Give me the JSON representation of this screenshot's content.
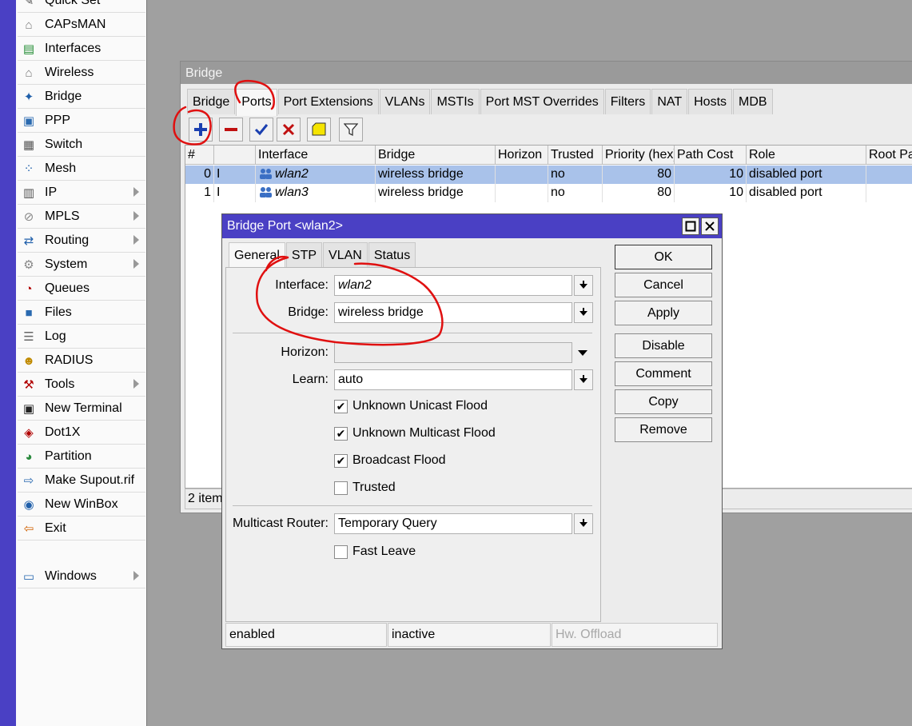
{
  "menu": {
    "items": [
      {
        "label": "Quick Set",
        "icon": "quick-set-icon",
        "glyph": "✎",
        "color": "#555"
      },
      {
        "label": "CAPsMAN",
        "icon": "capsman-icon",
        "glyph": "⌂",
        "color": "#777"
      },
      {
        "label": "Interfaces",
        "icon": "interfaces-icon",
        "glyph": "▤",
        "color": "#1d8a2f"
      },
      {
        "label": "Wireless",
        "icon": "wireless-icon",
        "glyph": "⌂",
        "color": "#777"
      },
      {
        "label": "Bridge",
        "icon": "bridge-icon",
        "glyph": "✦",
        "color": "#1f5faa"
      },
      {
        "label": "PPP",
        "icon": "ppp-icon",
        "glyph": "▣",
        "color": "#2a6ab0"
      },
      {
        "label": "Switch",
        "icon": "switch-icon",
        "glyph": "▦",
        "color": "#555"
      },
      {
        "label": "Mesh",
        "icon": "mesh-icon",
        "glyph": "⁘",
        "color": "#1f5faa"
      },
      {
        "label": "IP",
        "icon": "ip-icon",
        "glyph": "▥",
        "color": "#555",
        "submenu": true
      },
      {
        "label": "MPLS",
        "icon": "mpls-icon",
        "glyph": "⊘",
        "color": "#888",
        "submenu": true
      },
      {
        "label": "Routing",
        "icon": "routing-icon",
        "glyph": "⇄",
        "color": "#1f5faa",
        "submenu": true
      },
      {
        "label": "System",
        "icon": "system-icon",
        "glyph": "⚙",
        "color": "#888",
        "submenu": true
      },
      {
        "label": "Queues",
        "icon": "queues-icon",
        "glyph": "◔",
        "color": "#b00000"
      },
      {
        "label": "Files",
        "icon": "files-icon",
        "glyph": "■",
        "color": "#2a6ab0"
      },
      {
        "label": "Log",
        "icon": "log-icon",
        "glyph": "☰",
        "color": "#666"
      },
      {
        "label": "RADIUS",
        "icon": "radius-icon",
        "glyph": "☻",
        "color": "#c08a00"
      },
      {
        "label": "Tools",
        "icon": "tools-icon",
        "glyph": "⚒",
        "color": "#b00000",
        "submenu": true
      },
      {
        "label": "New Terminal",
        "icon": "terminal-icon",
        "glyph": "▣",
        "color": "#222"
      },
      {
        "label": "Dot1X",
        "icon": "dot1x-icon",
        "glyph": "◈",
        "color": "#b00000"
      },
      {
        "label": "Partition",
        "icon": "partition-icon",
        "glyph": "◕",
        "color": "#2b8a3e"
      },
      {
        "label": "Make Supout.rif",
        "icon": "supout-icon",
        "glyph": "⇨",
        "color": "#2a6ab0"
      },
      {
        "label": "New WinBox",
        "icon": "winbox-icon",
        "glyph": "◉",
        "color": "#1f5faa"
      },
      {
        "label": "Exit",
        "icon": "exit-icon",
        "glyph": "⇦",
        "color": "#d06000"
      },
      {
        "label": "",
        "icon": "",
        "glyph": "",
        "color": "#000"
      },
      {
        "label": "Windows",
        "icon": "windows-icon",
        "glyph": "▭",
        "color": "#2a6ab0",
        "submenu": true
      }
    ]
  },
  "bridge_window": {
    "title": "Bridge",
    "tabs": [
      "Bridge",
      "Ports",
      "Port Extensions",
      "VLANs",
      "MSTIs",
      "Port MST Overrides",
      "Filters",
      "NAT",
      "Hosts",
      "MDB"
    ],
    "active_tab": "Ports",
    "columns": [
      "#",
      "",
      "Interface",
      "Bridge",
      "Horizon",
      "Trusted",
      "Priority (hex)",
      "Path Cost",
      "Role",
      "Root Pa"
    ],
    "rows": [
      {
        "num": "0",
        "flag": "I",
        "interface": "wlan2",
        "bridge": "wireless bridge",
        "horizon": "",
        "trusted": "no",
        "priority": "80",
        "path_cost": "10",
        "role": "disabled port",
        "selected": true
      },
      {
        "num": "1",
        "flag": "I",
        "interface": "wlan3",
        "bridge": "wireless bridge",
        "horizon": "",
        "trusted": "no",
        "priority": "80",
        "path_cost": "10",
        "role": "disabled port",
        "selected": false
      }
    ],
    "status": "2 item"
  },
  "dialog": {
    "title": "Bridge Port <wlan2>",
    "tabs": [
      "General",
      "STP",
      "VLAN",
      "Status"
    ],
    "active_tab": "General",
    "fields": {
      "interface_label": "Interface:",
      "interface_value": "wlan2",
      "bridge_label": "Bridge:",
      "bridge_value": "wireless bridge",
      "horizon_label": "Horizon:",
      "horizon_value": "",
      "learn_label": "Learn:",
      "learn_value": "auto",
      "multicast_router_label": "Multicast Router:",
      "multicast_router_value": "Temporary Query"
    },
    "checkboxes": {
      "unknown_unicast_flood": {
        "label": "Unknown Unicast Flood",
        "checked": true
      },
      "unknown_multicast_flood": {
        "label": "Unknown Multicast Flood",
        "checked": true
      },
      "broadcast_flood": {
        "label": "Broadcast Flood",
        "checked": true
      },
      "trusted": {
        "label": "Trusted",
        "checked": false
      },
      "fast_leave": {
        "label": "Fast Leave",
        "checked": false
      }
    },
    "buttons": {
      "ok": "OK",
      "cancel": "Cancel",
      "apply": "Apply",
      "disable": "Disable",
      "comment": "Comment",
      "copy": "Copy",
      "remove": "Remove"
    },
    "status": {
      "enabled": "enabled",
      "running": "inactive",
      "hw_offload": "Hw. Offload"
    }
  },
  "colors": {
    "accent": "#4a40c4",
    "selection": "#a9c2ea",
    "annotation": "#e01010"
  }
}
